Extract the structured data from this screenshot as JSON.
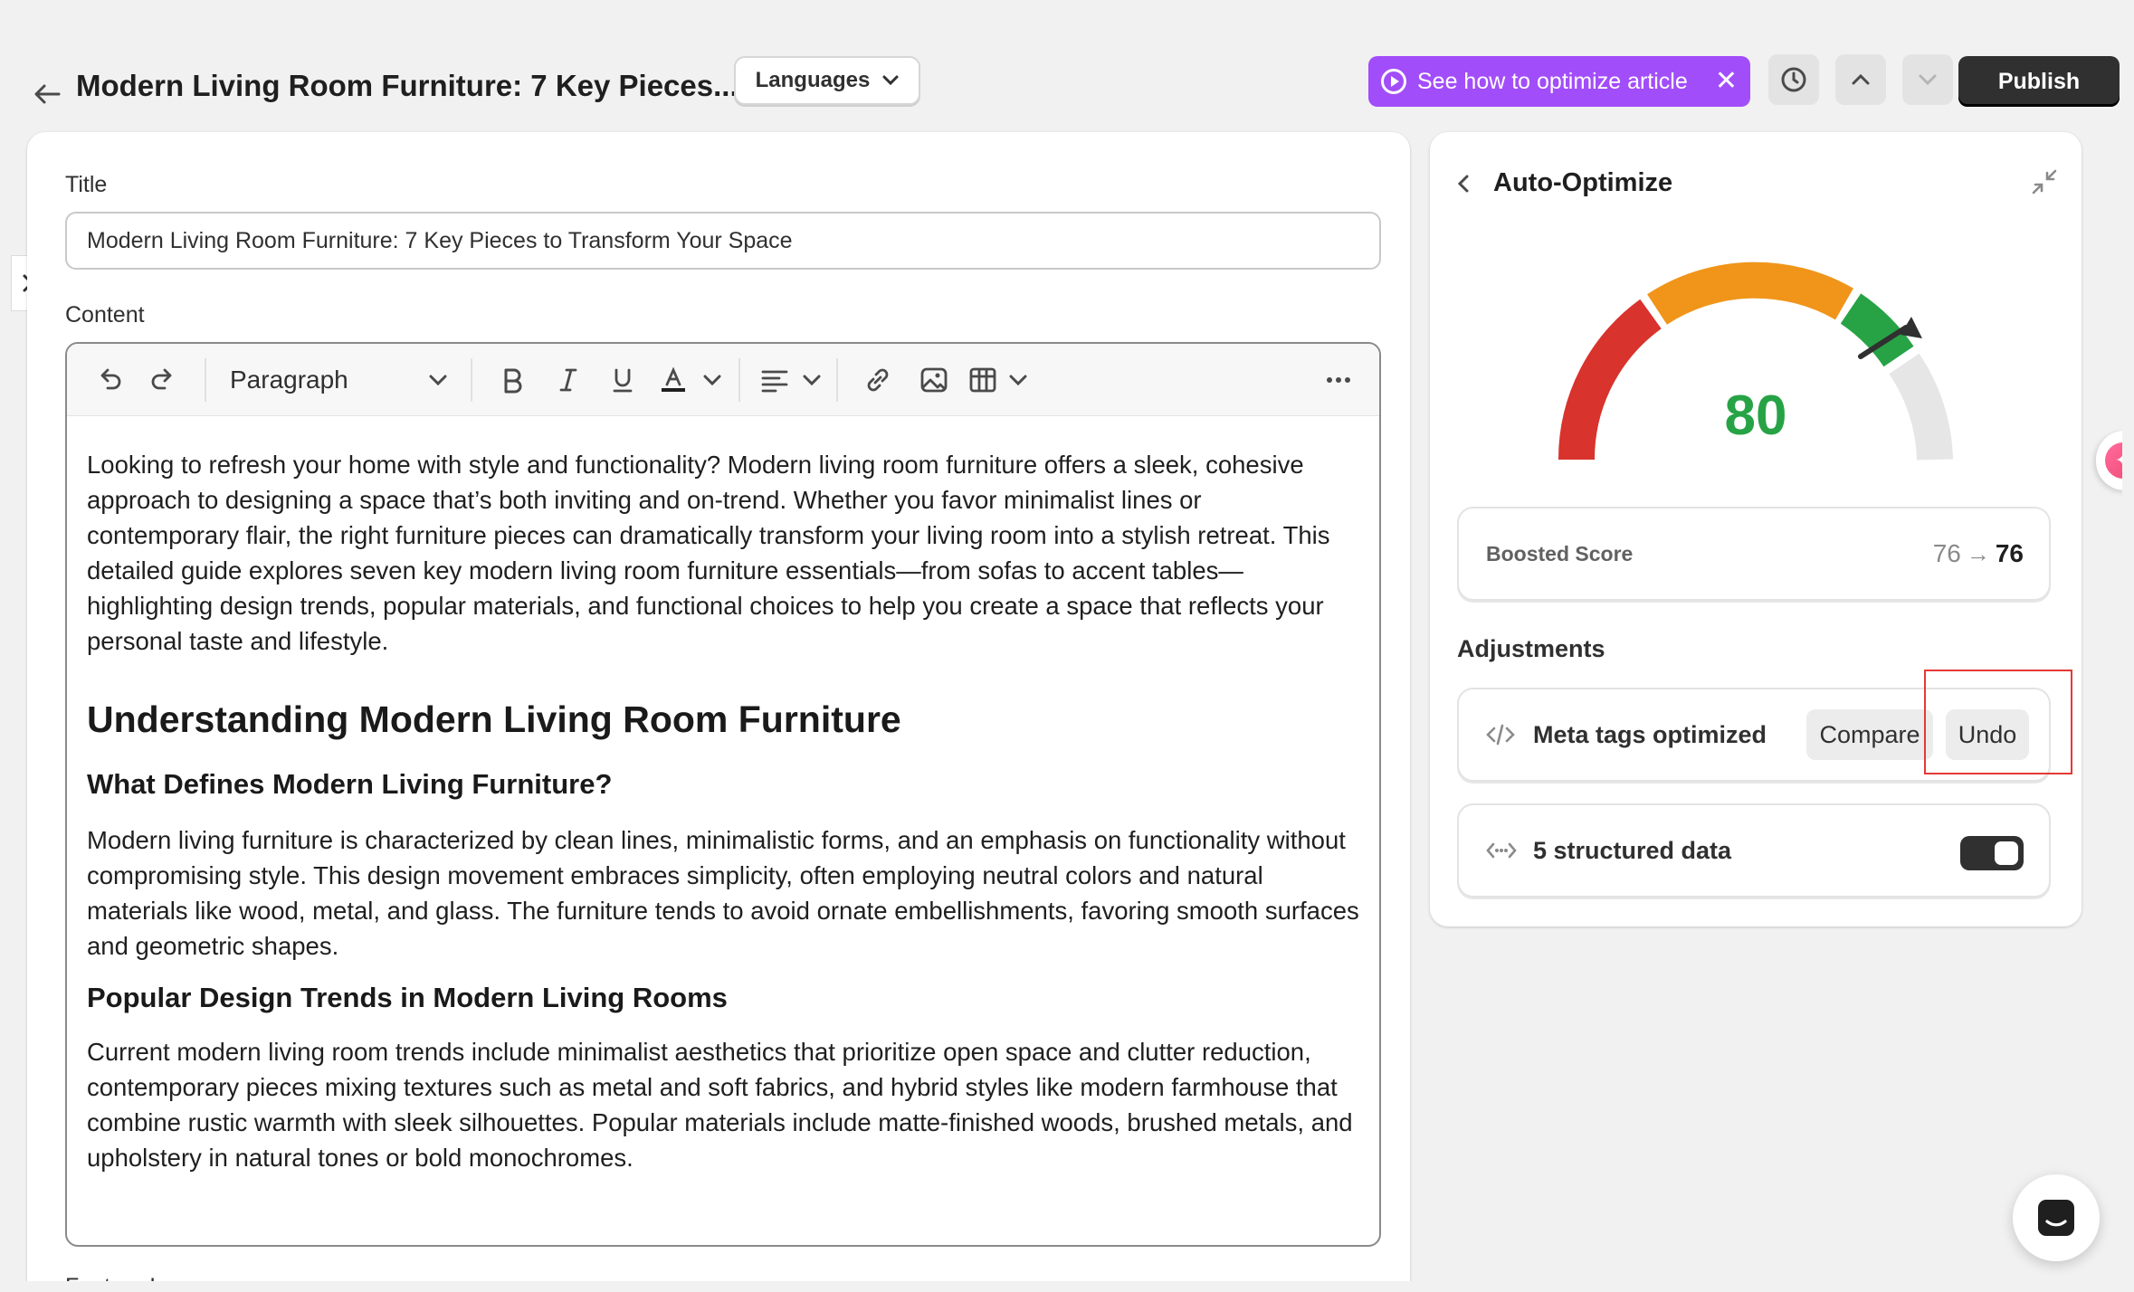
{
  "header": {
    "page_title": "Modern Living Room Furniture: 7 Key Pieces...",
    "languages_label": "Languages",
    "optimize_label": "See how to optimize article",
    "publish_label": "Publish"
  },
  "editor": {
    "title_label": "Title",
    "title_value": "Modern Living Room Furniture: 7 Key Pieces to Transform Your Space",
    "content_label": "Content",
    "paragraph_style": "Paragraph",
    "blocks": {
      "p1": "Looking to refresh your home with style and functionality? Modern living room furniture offers a sleek, cohesive approach to designing a space that’s both inviting and on-trend. Whether you favor minimalist lines or contemporary flair, the right furniture pieces can dramatically transform your living room into a stylish retreat. This detailed guide explores seven key modern living room furniture essentials—from sofas to accent tables—highlighting design trends, popular materials, and functional choices to help you create a space that reflects your personal taste and lifestyle.",
      "h1": "Understanding Modern Living Room Furniture",
      "h2a": "What Defines Modern Living Furniture?",
      "p2": "Modern living furniture is characterized by clean lines, minimalistic forms, and an emphasis on functionality without compromising style. This design movement embraces simplicity, often employing neutral colors and natural materials like wood, metal, and glass. The furniture tends to avoid ornate embellishments, favoring smooth surfaces and geometric shapes.",
      "h2b": "Popular Design Trends in Modern Living Rooms",
      "p3": "Current modern living room trends include minimalist aesthetics that prioritize open space and clutter reduction, contemporary pieces mixing textures such as metal and soft fabrics, and hybrid styles like modern farmhouse that combine rustic warmth with sleek silhouettes. Popular materials include matte-finished woods, brushed metals, and upholstery in natural tones or bold monochromes."
    },
    "feature_image_label": "Feature Image"
  },
  "optimize_panel": {
    "title": "Auto-Optimize",
    "score": "80",
    "gauge_value": 80,
    "gauge_colors": [
      "#d8332c",
      "#f0951a",
      "#27a346",
      "#e6e6e6"
    ],
    "boosted_label": "Boosted Score",
    "boosted_old": "76",
    "boosted_new": "76",
    "adjustments_title": "Adjustments",
    "meta_tags_label": "Meta tags optimized",
    "compare_label": "Compare",
    "undo_label": "Undo",
    "structured_label": "5 structured data",
    "structured_enabled": true
  }
}
